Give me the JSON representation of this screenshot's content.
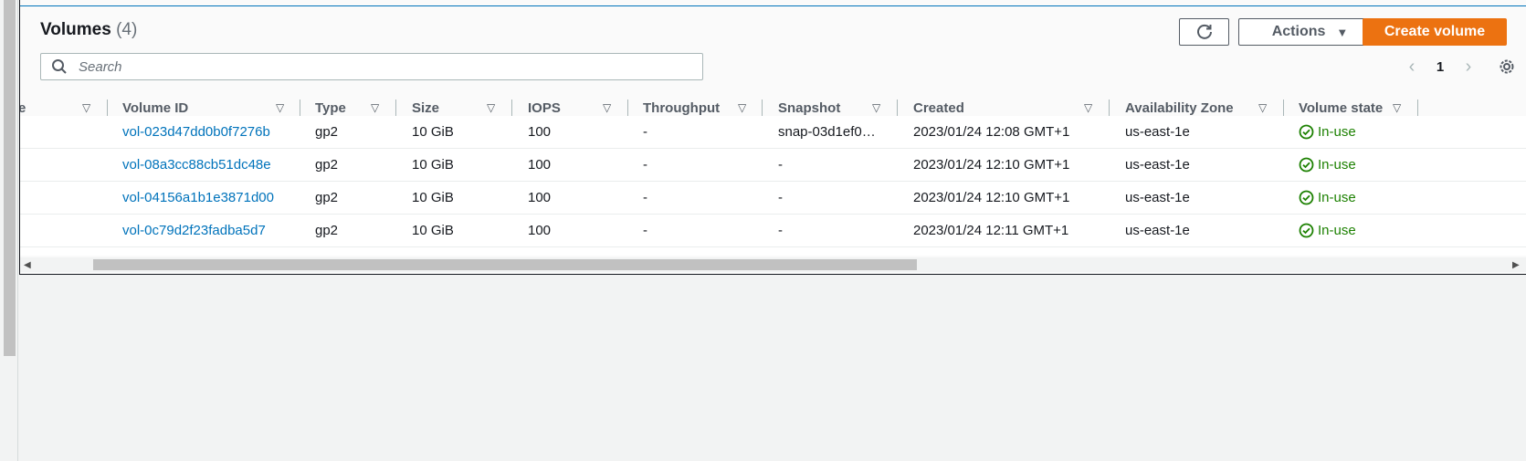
{
  "header": {
    "title": "Volumes",
    "count": "(4)",
    "actions_label": "Actions",
    "create_label": "Create volume"
  },
  "search": {
    "placeholder": "Search"
  },
  "pagination": {
    "current_page": "1"
  },
  "table": {
    "columns": [
      "e",
      "Volume ID",
      "Type",
      "Size",
      "IOPS",
      "Throughput",
      "Snapshot",
      "Created",
      "Availability Zone",
      "Volume state"
    ],
    "rows": [
      {
        "volume_id": "vol-023d47dd0b0f7276b",
        "type": "gp2",
        "size": "10 GiB",
        "iops": "100",
        "throughput": "-",
        "snapshot": "snap-03d1ef0…",
        "created": "2023/01/24 12:08 GMT+1",
        "az": "us-east-1e",
        "state": "In-use"
      },
      {
        "volume_id": "vol-08a3cc88cb51dc48e",
        "type": "gp2",
        "size": "10 GiB",
        "iops": "100",
        "throughput": "-",
        "snapshot": "-",
        "created": "2023/01/24 12:10 GMT+1",
        "az": "us-east-1e",
        "state": "In-use"
      },
      {
        "volume_id": "vol-04156a1b1e3871d00",
        "type": "gp2",
        "size": "10 GiB",
        "iops": "100",
        "throughput": "-",
        "snapshot": "-",
        "created": "2023/01/24 12:10 GMT+1",
        "az": "us-east-1e",
        "state": "In-use"
      },
      {
        "volume_id": "vol-0c79d2f23fadba5d7",
        "type": "gp2",
        "size": "10 GiB",
        "iops": "100",
        "throughput": "-",
        "snapshot": "-",
        "created": "2023/01/24 12:11 GMT+1",
        "az": "us-east-1e",
        "state": "In-use"
      }
    ]
  },
  "colors": {
    "accent": "#ec7211",
    "link": "#0073bb",
    "success": "#1d8102"
  },
  "icons": {
    "refresh": "refresh-icon",
    "search": "search-icon",
    "settings": "gear-icon",
    "status": "check-circle-icon"
  }
}
